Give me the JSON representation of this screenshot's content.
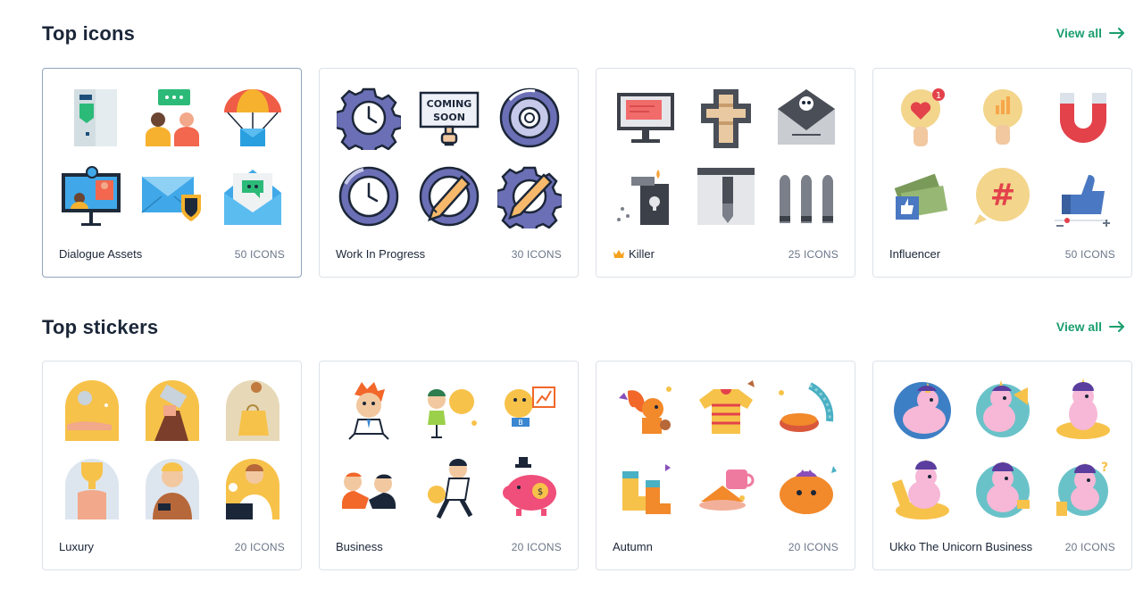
{
  "icons_section": {
    "title": "Top icons",
    "view_all": "View all",
    "cards": [
      {
        "name": "Dialogue Assets",
        "count": "50 ICONS"
      },
      {
        "name": "Work In Progress",
        "count": "30 ICONS"
      },
      {
        "name": "Killer",
        "count": "25 ICONS",
        "premium_icon": "crown-icon"
      },
      {
        "name": "Influencer",
        "count": "50 ICONS"
      }
    ]
  },
  "stickers_section": {
    "title": "Top stickers",
    "view_all": "View all",
    "cards": [
      {
        "name": "Luxury",
        "count": "20 ICONS"
      },
      {
        "name": "Business",
        "count": "20 ICONS"
      },
      {
        "name": "Autumn",
        "count": "20 ICONS"
      },
      {
        "name": "Ukko The Unicorn Business",
        "count": "20 ICONS"
      }
    ]
  },
  "coming_soon_sign": "COMING SOON",
  "colors": {
    "accent": "#1a9e6e",
    "crown": "#f4a21b"
  }
}
